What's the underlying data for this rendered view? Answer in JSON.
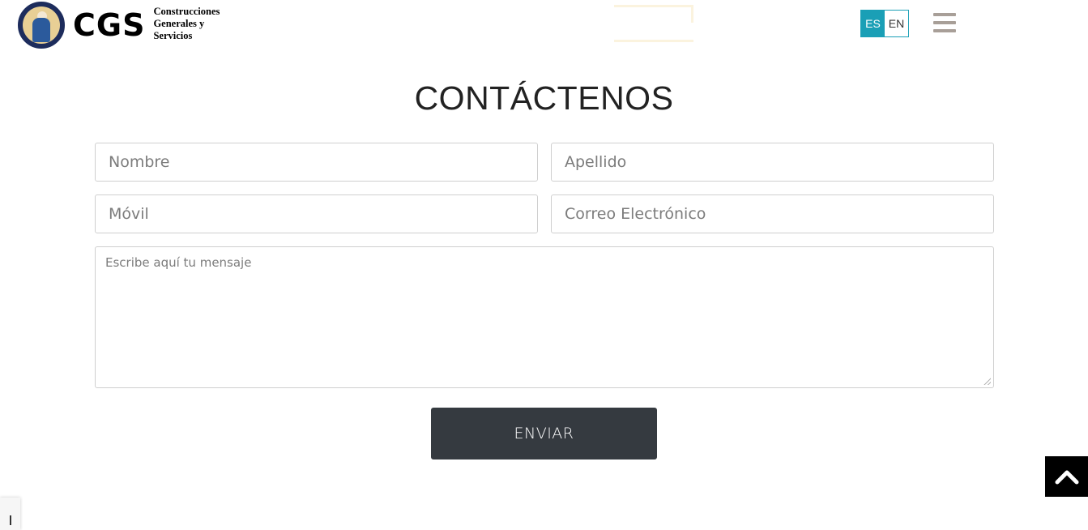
{
  "header": {
    "logo_mark": "CGS",
    "logo_subtitle_lines": [
      "Construcciones",
      "Generales y",
      "Servicios"
    ],
    "languages": {
      "es": "ES",
      "en": "EN",
      "active": "ES"
    },
    "menu_icon": "hamburger-icon"
  },
  "main": {
    "title": "CONTÁCTENOS",
    "form": {
      "nombre": {
        "value": "",
        "placeholder": "Nombre"
      },
      "apellido": {
        "value": "",
        "placeholder": "Apellido"
      },
      "movil": {
        "value": "",
        "placeholder": "Móvil"
      },
      "correo": {
        "value": "",
        "placeholder": "Correo Electrónico"
      },
      "mensaje": {
        "value": "",
        "placeholder": "Escribe aquí tu mensaje"
      },
      "submit_label": "ENVIAR"
    }
  },
  "widgets": {
    "back_to_top_icon": "chevron-up-icon"
  },
  "colors": {
    "accent": "#1a9fb6",
    "button": "#353a40",
    "menu_icon": "#a89f98",
    "logo_navy": "#1d2c5c"
  }
}
